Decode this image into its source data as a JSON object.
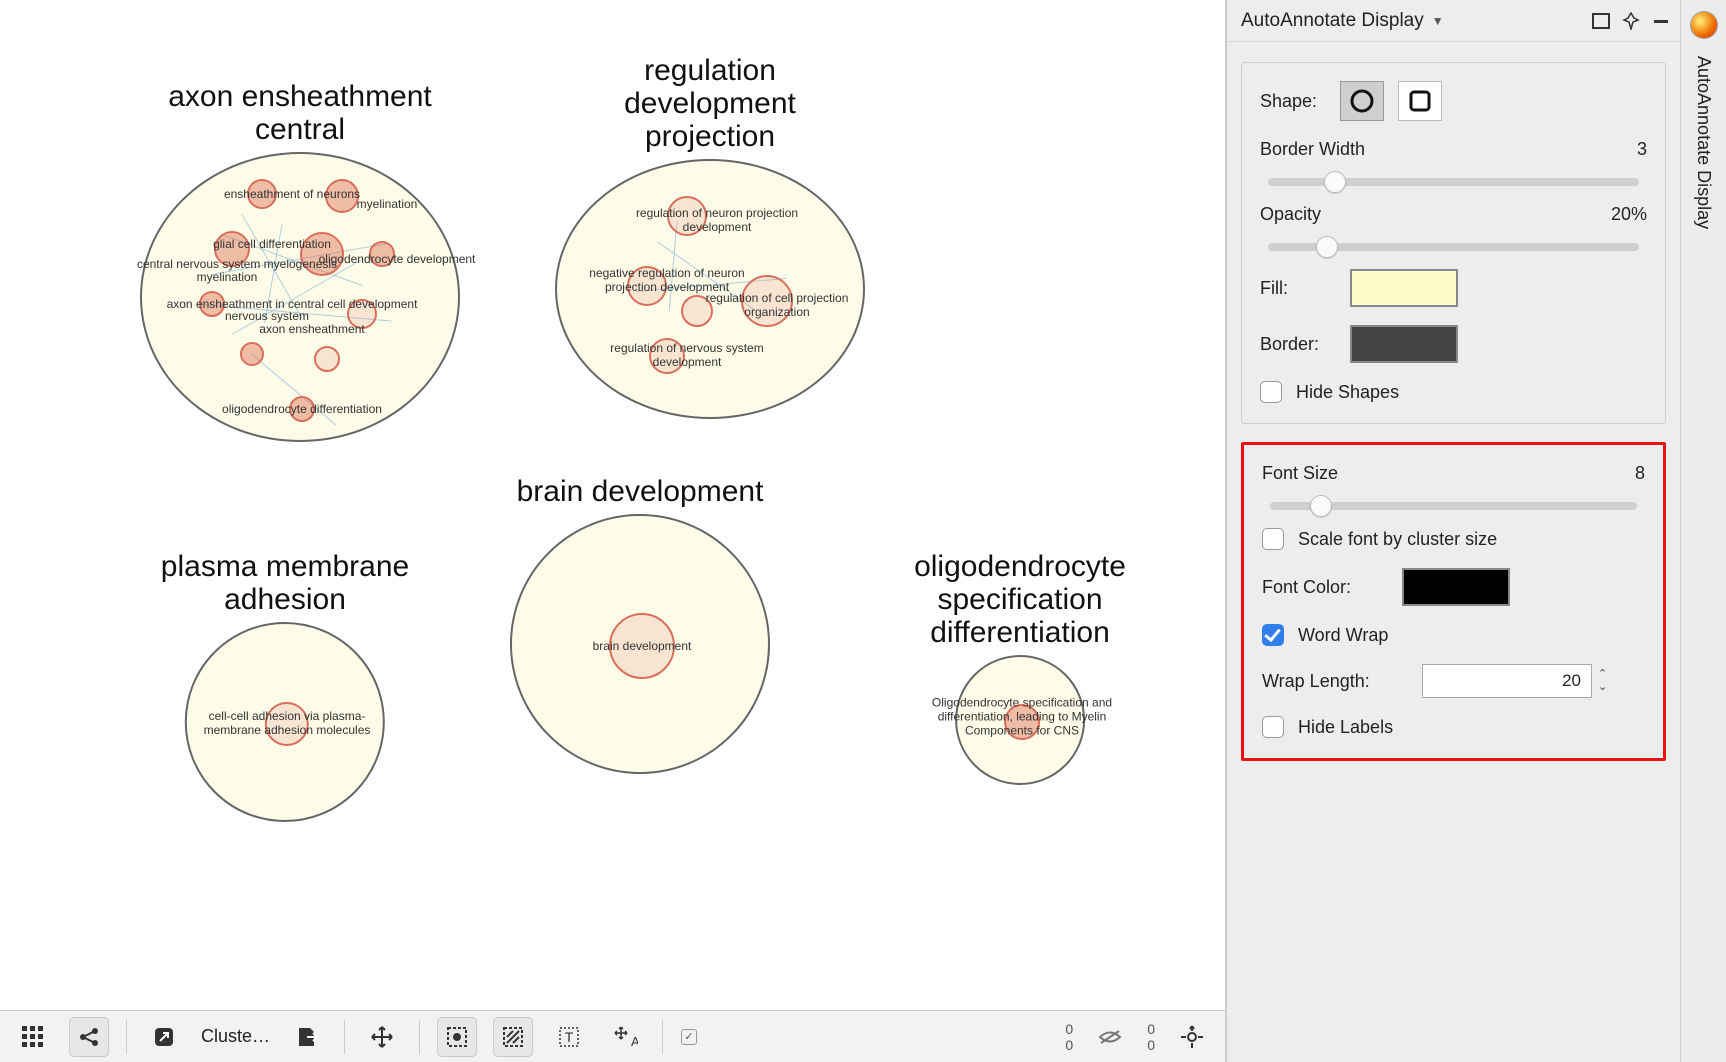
{
  "panel": {
    "title": "AutoAnnotate Display",
    "shape_label": "Shape:",
    "border_width": {
      "label": "Border Width",
      "value": "3"
    },
    "opacity": {
      "label": "Opacity",
      "value": "20%"
    },
    "fill_label": "Fill:",
    "border_label": "Border:",
    "hide_shapes": "Hide Shapes",
    "font_size": {
      "label": "Font Size",
      "value": "8"
    },
    "scale_font": "Scale font by cluster size",
    "font_color_label": "Font Color:",
    "word_wrap": "Word Wrap",
    "wrap_length": {
      "label": "Wrap Length:",
      "value": "20"
    },
    "hide_labels": "Hide Labels"
  },
  "sidetab": {
    "label": "AutoAnnotate Display"
  },
  "bottombar": {
    "clusters_label": "Cluste…",
    "counter1_top": "0",
    "counter1_bot": "0",
    "counter2_top": "0",
    "counter2_bot": "0"
  },
  "clusters": [
    {
      "title": "axon ensheathment\ncentral",
      "nodes": [
        "ensheathment of neurons",
        "myelination",
        "glial cell differentiation",
        "oligodendrocyte development",
        "central nervous system myelogenesis",
        "myelination",
        "axon ensheathment in central cell development",
        "nervous system",
        "axon ensheathment",
        "oligodendrocyte differentiation"
      ]
    },
    {
      "title": "regulation\ndevelopment\nprojection",
      "nodes": [
        "regulation of neuron projection development",
        "negative regulation of neuron projection development",
        "regulation of cell projection organization",
        "regulation of nervous system development"
      ]
    },
    {
      "title": "brain development",
      "nodes": [
        "brain development"
      ]
    },
    {
      "title": "plasma membrane\nadhesion",
      "nodes": [
        "cell-cell adhesion via plasma-membrane adhesion molecules"
      ]
    },
    {
      "title": "oligodendrocyte\nspecification\ndifferentiation",
      "nodes": [
        "Oligodendrocyte specification and differentiation, leading to Myelin Components for CNS"
      ]
    }
  ],
  "checkbox_small": "✓"
}
